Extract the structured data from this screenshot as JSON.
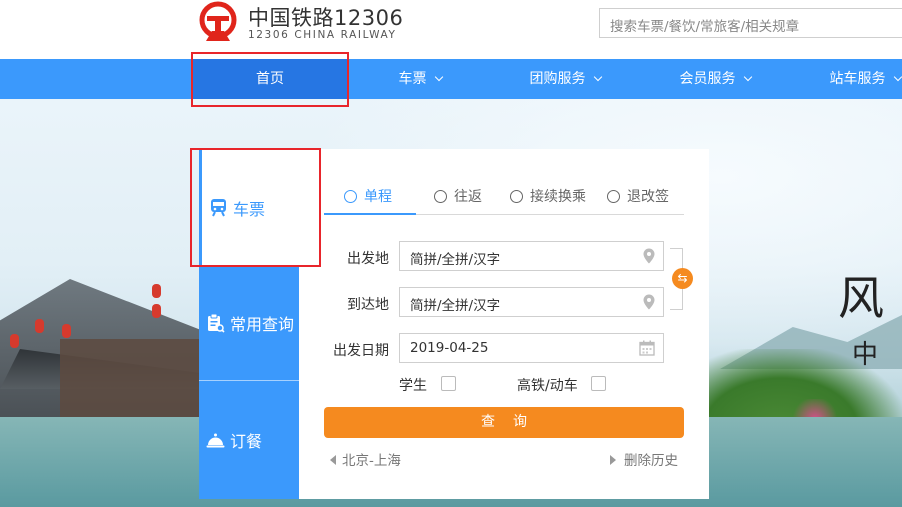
{
  "header": {
    "logo_cn": "中国铁路12306",
    "logo_en": "12306 CHINA RAILWAY",
    "search_placeholder": "搜索车票/餐饮/常旅客/相关规章"
  },
  "nav": {
    "items": [
      {
        "label": "首页",
        "dropdown": false,
        "active": true
      },
      {
        "label": "车票",
        "dropdown": true
      },
      {
        "label": "团购服务",
        "dropdown": true
      },
      {
        "label": "会员服务",
        "dropdown": true
      },
      {
        "label": "站车服务",
        "dropdown": true
      }
    ]
  },
  "sidebar": {
    "tabs": [
      {
        "label": "车票",
        "icon": "train-icon",
        "active": true
      },
      {
        "label": "常用查询",
        "icon": "clipboard-search-icon"
      },
      {
        "label": "订餐",
        "icon": "meal-cloche-icon"
      }
    ]
  },
  "booking": {
    "trip_tabs": [
      {
        "label": "单程",
        "active": true
      },
      {
        "label": "往返"
      },
      {
        "label": "接续换乘"
      },
      {
        "label": "退改签"
      }
    ],
    "from_label": "出发地",
    "from_placeholder": "简拼/全拼/汉字",
    "to_label": "到达地",
    "to_placeholder": "简拼/全拼/汉字",
    "date_label": "出发日期",
    "date_value": "2019-04-25",
    "student_label": "学生",
    "highspeed_label": "高铁/动车",
    "search_button": "查询",
    "history_item": "北京-上海",
    "clear_history": "删除历史"
  },
  "banner": {
    "slogan_line1": "风",
    "slogan_line2": "中"
  },
  "colors": {
    "nav_blue": "#3b99fc",
    "nav_active": "#2676e3",
    "accent_orange": "#f58a1f",
    "highlight_red": "#e8252b"
  }
}
